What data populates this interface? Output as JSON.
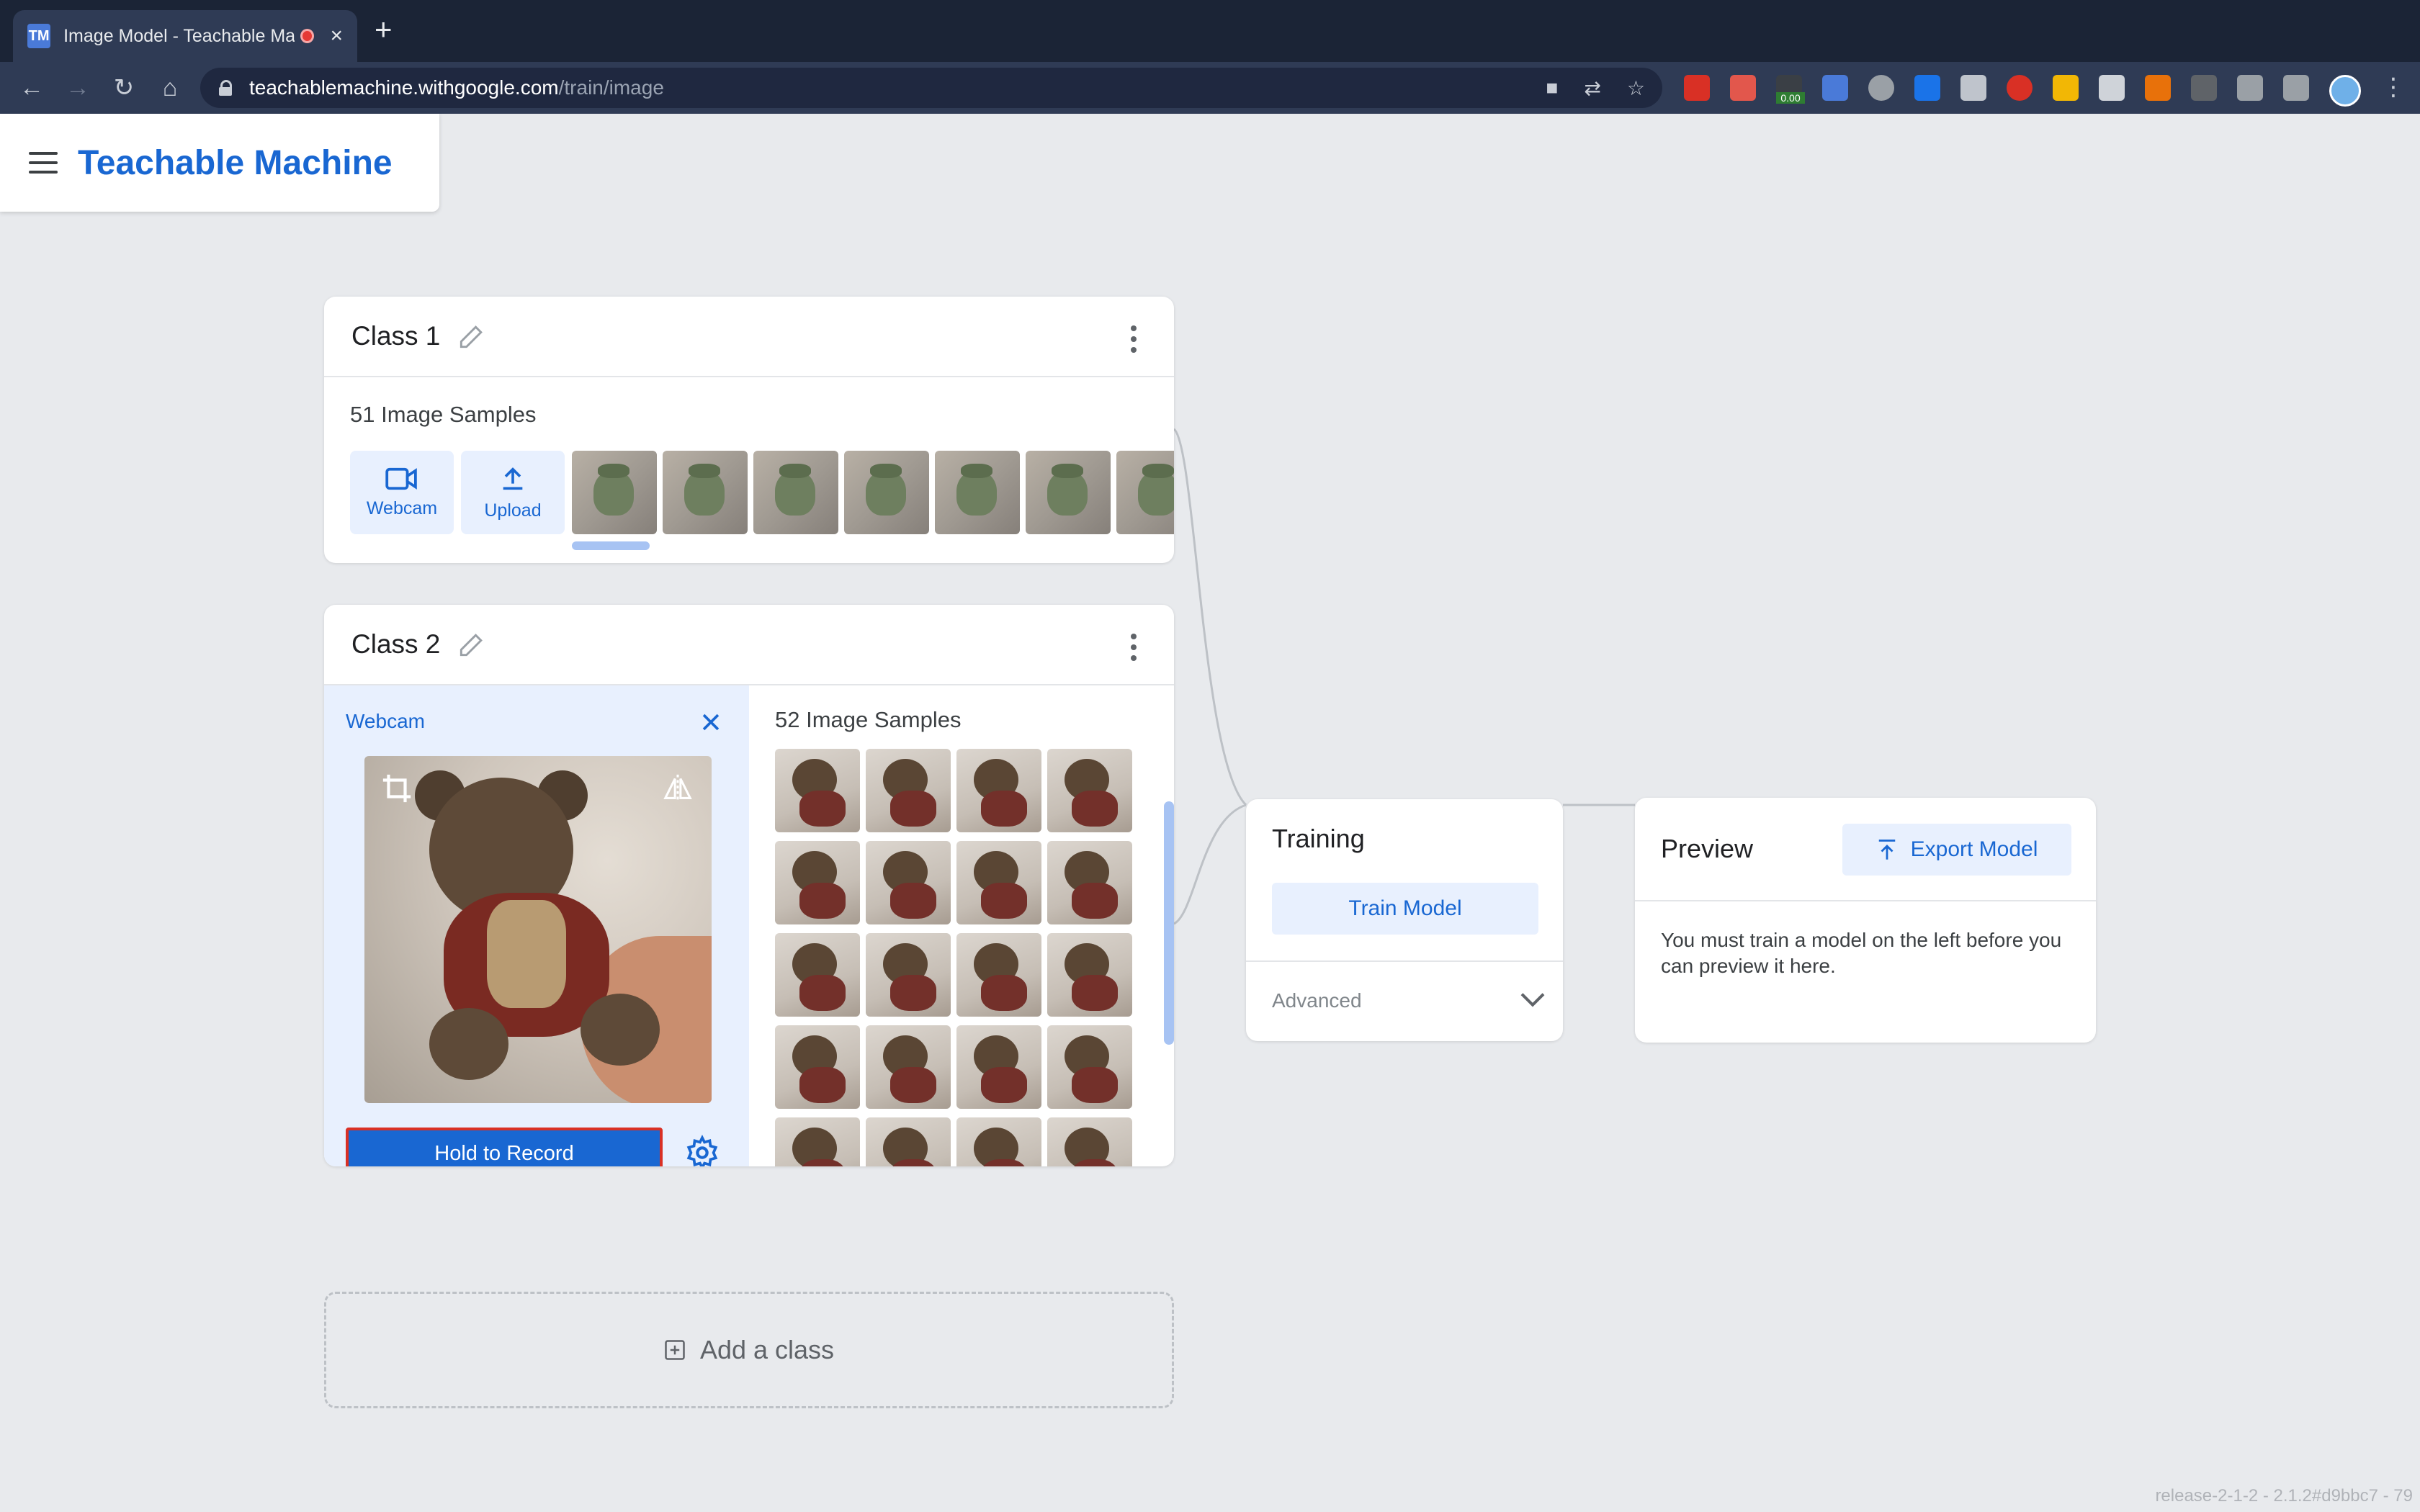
{
  "browser": {
    "tab_title": "Image Model - Teachable Machine",
    "favicon_text": "TM",
    "url_host": "teachablemachine.withgoogle.com",
    "url_path": "/train/image",
    "extension_badge": "0.00"
  },
  "app": {
    "brand": "Teachable Machine"
  },
  "class1": {
    "title": "Class 1",
    "samples": "51 Image Samples",
    "webcam_label": "Webcam",
    "upload_label": "Upload"
  },
  "class2": {
    "title": "Class 2",
    "webcam_header": "Webcam",
    "samples": "52 Image Samples",
    "record_label": "Hold to Record"
  },
  "add_class": {
    "label": "Add a class"
  },
  "training": {
    "title": "Training",
    "train_button": "Train Model",
    "advanced": "Advanced"
  },
  "preview": {
    "title": "Preview",
    "export_button": "Export Model",
    "message": "You must train a model on the left before you can preview it here."
  },
  "footer": {
    "version": "release-2-1-2 - 2.1.2#d9bbc7 - 79"
  },
  "colors": {
    "accent": "#1967d2",
    "accent_light": "#e8f0fe",
    "record_border": "#d93025",
    "page_bg": "#e8eaed"
  }
}
